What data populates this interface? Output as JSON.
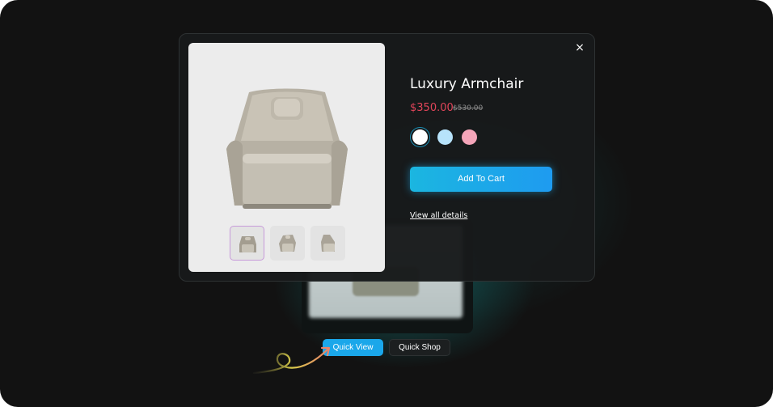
{
  "background_card": {
    "quick_view_label": "Quick View",
    "quick_shop_label": "Quick Shop"
  },
  "modal": {
    "close_icon": "×",
    "product_title": "Luxury Armchair",
    "price": "$350.00",
    "old_price": "$530.00",
    "color_options": [
      "#ffffff",
      "#b7e3fb",
      "#f4a5b9"
    ],
    "selected_color_index": 0,
    "add_to_cart_label": "Add To Cart",
    "view_details_label": "View all details",
    "thumbnails": [
      "armchair-front-thumbnail",
      "armchair-angle-thumbnail",
      "armchair-side-thumbnail"
    ],
    "active_thumbnail_index": 0
  },
  "colors": {
    "accent": "#1aa7ea",
    "price_red": "#e2455a"
  }
}
